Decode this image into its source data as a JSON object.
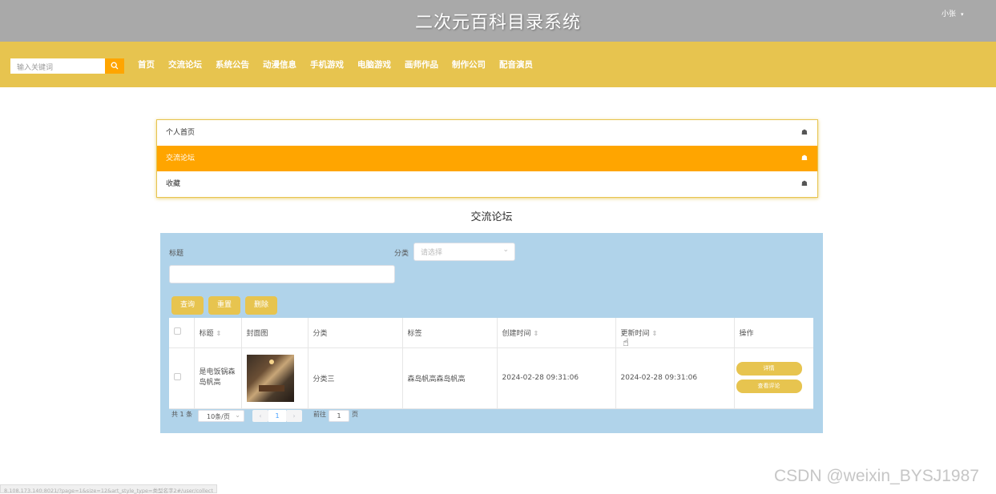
{
  "header": {
    "site_title": "二次元百科目录系统",
    "user_name": "小张",
    "user_caret": "▾"
  },
  "nav": {
    "search_placeholder": "输入关键词",
    "search_icon": "search-icon",
    "links": [
      "首页",
      "交流论坛",
      "系统公告",
      "动漫信息",
      "手机游戏",
      "电脑游戏",
      "画师作品",
      "制作公司",
      "配音演员"
    ]
  },
  "side_menu": {
    "items": [
      {
        "label": "个人首页",
        "icon": "home-icon",
        "active": false
      },
      {
        "label": "交流论坛",
        "icon": "home-icon",
        "active": true
      },
      {
        "label": "收藏",
        "icon": "home-icon",
        "active": false
      }
    ]
  },
  "main": {
    "section_title": "交流论坛",
    "filters": {
      "title_label": "标题",
      "title_value": "",
      "category_label": "分类",
      "category_placeholder": "请选择"
    },
    "buttons": {
      "query": "查询",
      "reset": "重置",
      "delete": "删除"
    },
    "table": {
      "columns": [
        "",
        "标题",
        "封面图",
        "分类",
        "标签",
        "创建时间",
        "更新时间",
        "操作"
      ],
      "sortable": [
        false,
        true,
        false,
        false,
        false,
        true,
        true,
        false
      ],
      "rows": [
        {
          "title": "是电饭锅森岛帆高",
          "cover": "cover-image",
          "category": "分类三",
          "tags": "森岛帆高森岛帆高",
          "created": "2024-02-28 09:31:06",
          "updated": "2024-02-28 09:31:06",
          "actions": [
            "详情",
            "查看评论"
          ]
        }
      ]
    },
    "pagination": {
      "total_text": "共 1 条",
      "page_size": "10条/页",
      "current_page": "1",
      "goto_label": "前往",
      "goto_value": "1",
      "page_suffix": "页"
    }
  },
  "status_bar": {
    "url": "8.108.173.140:8021/?page=1&size=12&art_style_type=类型名字2#/user/collect"
  },
  "watermark": "CSDN @weixin_BYSJ1987",
  "colors": {
    "topbar": "#a9a9a9",
    "navbar": "#e7c44f",
    "accent": "#ffa500",
    "panel": "#b0d3ea"
  }
}
